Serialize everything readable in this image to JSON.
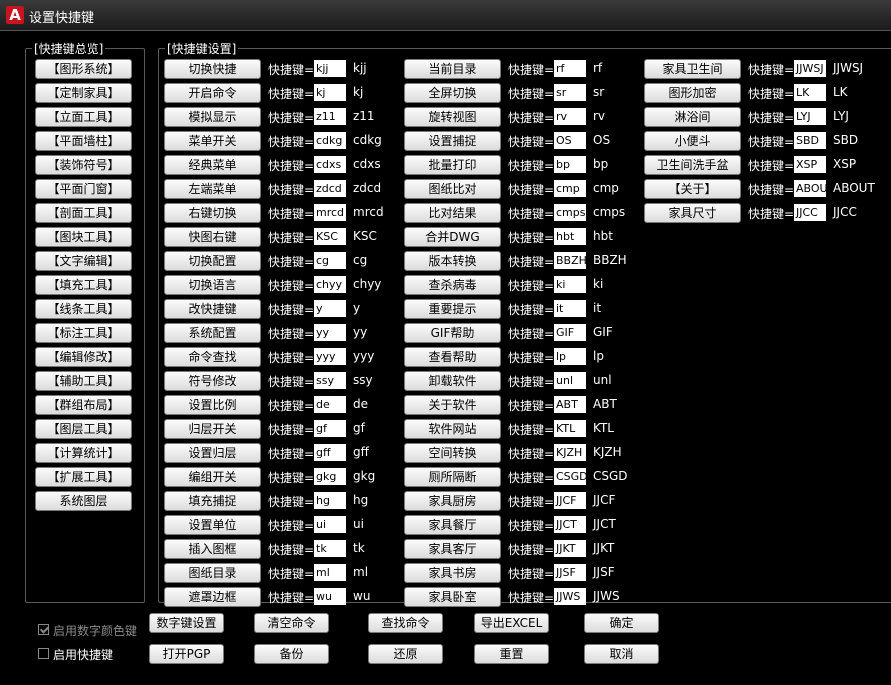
{
  "window": {
    "title": "设置快捷键",
    "app_icon": "autocad-a-icon",
    "app_icon_glyph": "A"
  },
  "overview": {
    "label": "[快捷键总览]",
    "items": [
      "【图形系统】",
      "【定制家具】",
      "【立面工具】",
      "【平面墙柱】",
      "【装饰符号】",
      "【平面门窗】",
      "【剖面工具】",
      "【图块工具】",
      "【文字编辑】",
      "【填充工具】",
      "【线条工具】",
      "【标注工具】",
      "【编辑修改】",
      "【辅助工具】",
      "【群组布局】",
      "【图层工具】",
      "【计算统计】",
      "【扩展工具】",
      "系统图层"
    ]
  },
  "settings": {
    "label": "[快捷键设置]",
    "prefix": "快捷键=",
    "columns": [
      [
        {
          "name": "切换快捷",
          "input": "kjj",
          "value": "kjj"
        },
        {
          "name": "开启命令",
          "input": "kj",
          "value": "kj"
        },
        {
          "name": "模拟显示",
          "input": "z11",
          "value": "z11"
        },
        {
          "name": "菜单开关",
          "input": "cdkg",
          "value": "cdkg"
        },
        {
          "name": "经典菜单",
          "input": "cdxs",
          "value": "cdxs"
        },
        {
          "name": "左端菜单",
          "input": "zdcd",
          "value": "zdcd"
        },
        {
          "name": "右键切换",
          "input": "mrcd",
          "value": "mrcd"
        },
        {
          "name": "快图右键",
          "input": "KSC",
          "value": "KSC"
        },
        {
          "name": "切换配置",
          "input": "cg",
          "value": "cg"
        },
        {
          "name": "切换语言",
          "input": "chyy",
          "value": "chyy"
        },
        {
          "name": "改快捷键",
          "input": "y",
          "value": "y"
        },
        {
          "name": "系统配置",
          "input": "yy",
          "value": "yy"
        },
        {
          "name": "命令查找",
          "input": "yyy",
          "value": "yyy"
        },
        {
          "name": "符号修改",
          "input": "ssy",
          "value": "ssy"
        },
        {
          "name": "设置比例",
          "input": "de",
          "value": "de"
        },
        {
          "name": "归层开关",
          "input": "gf",
          "value": "gf"
        },
        {
          "name": "设置归层",
          "input": "gff",
          "value": "gff"
        },
        {
          "name": "编组开关",
          "input": "gkg",
          "value": "gkg"
        },
        {
          "name": "填充捕捉",
          "input": "hg",
          "value": "hg"
        },
        {
          "name": "设置单位",
          "input": "ui",
          "value": "ui"
        },
        {
          "name": "插入图框",
          "input": "tk",
          "value": "tk"
        },
        {
          "name": "图纸目录",
          "input": "ml",
          "value": "ml"
        },
        {
          "name": "遮罩边框",
          "input": "wu",
          "value": "wu"
        }
      ],
      [
        {
          "name": "当前目录",
          "input": "rf",
          "value": "rf"
        },
        {
          "name": "全屏切换",
          "input": "sr",
          "value": "sr"
        },
        {
          "name": "旋转视图",
          "input": "rv",
          "value": "rv"
        },
        {
          "name": "设置捕捉",
          "input": "OS",
          "value": "OS"
        },
        {
          "name": "批量打印",
          "input": "bp",
          "value": "bp"
        },
        {
          "name": "图纸比对",
          "input": "cmp",
          "value": "cmp"
        },
        {
          "name": "比对结果",
          "input": "cmps",
          "value": "cmps"
        },
        {
          "name": "合并DWG",
          "input": "hbt",
          "value": "hbt"
        },
        {
          "name": "版本转换",
          "input": "BBZH",
          "value": "BBZH"
        },
        {
          "name": "查杀病毒",
          "input": "ki",
          "value": "ki"
        },
        {
          "name": "重要提示",
          "input": "it",
          "value": "it"
        },
        {
          "name": "GIF帮助",
          "input": "GIF",
          "value": "GIF"
        },
        {
          "name": "查看帮助",
          "input": "lp",
          "value": "lp"
        },
        {
          "name": "卸载软件",
          "input": "unl",
          "value": "unl"
        },
        {
          "name": "关于软件",
          "input": "ABT",
          "value": "ABT"
        },
        {
          "name": "软件网站",
          "input": "KTL",
          "value": "KTL"
        },
        {
          "name": "空间转换",
          "input": "KJZH",
          "value": "KJZH"
        },
        {
          "name": "厕所隔断",
          "input": "CSGD",
          "value": "CSGD"
        },
        {
          "name": "家具厨房",
          "input": "JJCF",
          "value": "JJCF"
        },
        {
          "name": "家具餐厅",
          "input": "JJCT",
          "value": "JJCT"
        },
        {
          "name": "家具客厅",
          "input": "JJKT",
          "value": "JJKT"
        },
        {
          "name": "家具书房",
          "input": "JJSF",
          "value": "JJSF"
        },
        {
          "name": "家具卧室",
          "input": "JJWS",
          "value": "JJWS"
        }
      ],
      [
        {
          "name": "家具卫生间",
          "input": "JJWSJ",
          "value": "JJWSJ"
        },
        {
          "name": "图形加密",
          "input": "LK",
          "value": "LK"
        },
        {
          "name": "淋浴间",
          "input": "LYJ",
          "value": "LYJ"
        },
        {
          "name": "小便斗",
          "input": "SBD",
          "value": "SBD"
        },
        {
          "name": "卫生间洗手盆",
          "input": "XSP",
          "value": "XSP"
        },
        {
          "name": "【关于】",
          "input": "ABOUT",
          "value": "ABOUT"
        },
        {
          "name": "家具尺寸",
          "input": "JJCC",
          "value": "JJCC"
        }
      ]
    ]
  },
  "options": {
    "enable_numeric_color": {
      "label": "启用数字颜色键",
      "checked": true,
      "disabled": true
    },
    "enable_shortcuts": {
      "label": "启用快捷键",
      "checked": false
    }
  },
  "buttons_row1": [
    "数字键设置",
    "清空命令",
    "查找命令",
    "导出EXCEL",
    "确定"
  ],
  "buttons_row2": [
    "打开PGP",
    "备份",
    "还原",
    "重置",
    "取消"
  ]
}
